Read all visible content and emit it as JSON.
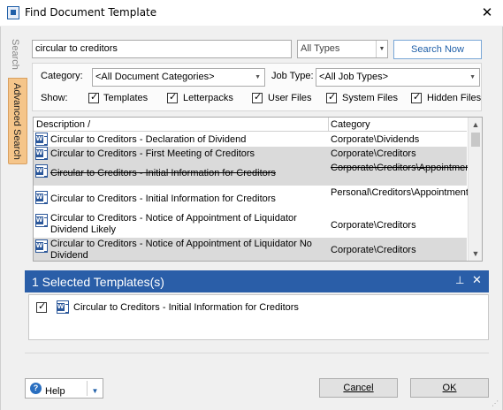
{
  "window": {
    "title": "Find Document Template",
    "close_glyph": "✕"
  },
  "side_tabs": {
    "search": "Search",
    "advanced": "Advanced Search"
  },
  "search": {
    "query": "circular to creditors",
    "type_selected": "All Types",
    "search_button": "Search Now"
  },
  "filters": {
    "category_label": "Category:",
    "category_selected": "<All Document Categories>",
    "job_type_label": "Job Type:",
    "job_type_selected": "<All Job Types>",
    "show_label": "Show:",
    "checkboxes": [
      {
        "label": "Templates",
        "checked": true
      },
      {
        "label": "Letterpacks",
        "checked": true
      },
      {
        "label": "User Files",
        "checked": true
      },
      {
        "label": "System Files",
        "checked": true
      },
      {
        "label": "Hidden Files",
        "checked": true
      }
    ]
  },
  "list": {
    "columns": [
      "Description /",
      "Category"
    ],
    "rows": [
      {
        "description": "Circular to Creditors - Declaration of Dividend",
        "category": "Corporate\\Dividends",
        "selected": false,
        "strikethrough": false
      },
      {
        "description": "Circular to Creditors - First Meeting of Creditors",
        "category": "Corporate\\Creditors",
        "selected": true,
        "strikethrough": false
      },
      {
        "description": "Circular to Creditors - Initial Information for Creditors",
        "category": "Corporate\\Creditors\\Appointment",
        "selected": true,
        "strikethrough": true
      },
      {
        "description": "Circular to Creditors - Initial Information for Creditors",
        "category": "Personal\\Creditors\\Appointment",
        "selected": false,
        "strikethrough": false
      },
      {
        "description": "Circular to Creditors - Notice of Appointment of Liquidator Dividend Likely",
        "category": "Corporate\\Creditors",
        "selected": false,
        "strikethrough": false
      },
      {
        "description": "Circular to Creditors - Notice of Appointment of Liquidator No Dividend",
        "category": "Corporate\\Creditors",
        "selected": true,
        "strikethrough": false
      }
    ]
  },
  "selected_panel": {
    "title": "1 Selected Templates(s)",
    "pin_glyph": "📌",
    "close_glyph": "✕",
    "items": [
      {
        "label": "Circular to Creditors - Initial Information for Creditors",
        "checked": true
      }
    ]
  },
  "buttons": {
    "help": "Help",
    "cancel": "Cancel",
    "ok": "OK"
  },
  "icons": {
    "app": "window-icon",
    "doc": "word-document-icon",
    "help": "question-circle-icon"
  },
  "colors": {
    "panel_header": "#2a5ea8",
    "advanced_tab": "#f5c58a",
    "selection": "#dadada"
  }
}
